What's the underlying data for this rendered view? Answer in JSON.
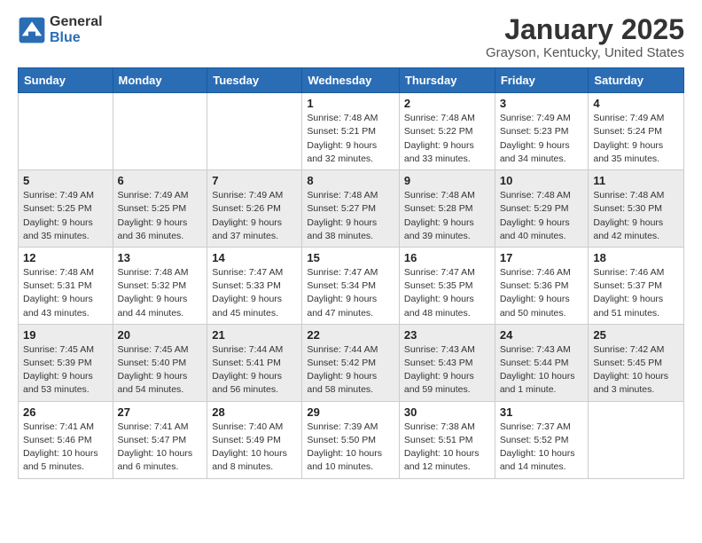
{
  "logo": {
    "general": "General",
    "blue": "Blue"
  },
  "title": "January 2025",
  "location": "Grayson, Kentucky, United States",
  "days_of_week": [
    "Sunday",
    "Monday",
    "Tuesday",
    "Wednesday",
    "Thursday",
    "Friday",
    "Saturday"
  ],
  "weeks": [
    [
      {
        "day": "",
        "info": ""
      },
      {
        "day": "",
        "info": ""
      },
      {
        "day": "",
        "info": ""
      },
      {
        "day": "1",
        "info": "Sunrise: 7:48 AM\nSunset: 5:21 PM\nDaylight: 9 hours and 32 minutes."
      },
      {
        "day": "2",
        "info": "Sunrise: 7:48 AM\nSunset: 5:22 PM\nDaylight: 9 hours and 33 minutes."
      },
      {
        "day": "3",
        "info": "Sunrise: 7:49 AM\nSunset: 5:23 PM\nDaylight: 9 hours and 34 minutes."
      },
      {
        "day": "4",
        "info": "Sunrise: 7:49 AM\nSunset: 5:24 PM\nDaylight: 9 hours and 35 minutes."
      }
    ],
    [
      {
        "day": "5",
        "info": "Sunrise: 7:49 AM\nSunset: 5:25 PM\nDaylight: 9 hours and 35 minutes."
      },
      {
        "day": "6",
        "info": "Sunrise: 7:49 AM\nSunset: 5:25 PM\nDaylight: 9 hours and 36 minutes."
      },
      {
        "day": "7",
        "info": "Sunrise: 7:49 AM\nSunset: 5:26 PM\nDaylight: 9 hours and 37 minutes."
      },
      {
        "day": "8",
        "info": "Sunrise: 7:48 AM\nSunset: 5:27 PM\nDaylight: 9 hours and 38 minutes."
      },
      {
        "day": "9",
        "info": "Sunrise: 7:48 AM\nSunset: 5:28 PM\nDaylight: 9 hours and 39 minutes."
      },
      {
        "day": "10",
        "info": "Sunrise: 7:48 AM\nSunset: 5:29 PM\nDaylight: 9 hours and 40 minutes."
      },
      {
        "day": "11",
        "info": "Sunrise: 7:48 AM\nSunset: 5:30 PM\nDaylight: 9 hours and 42 minutes."
      }
    ],
    [
      {
        "day": "12",
        "info": "Sunrise: 7:48 AM\nSunset: 5:31 PM\nDaylight: 9 hours and 43 minutes."
      },
      {
        "day": "13",
        "info": "Sunrise: 7:48 AM\nSunset: 5:32 PM\nDaylight: 9 hours and 44 minutes."
      },
      {
        "day": "14",
        "info": "Sunrise: 7:47 AM\nSunset: 5:33 PM\nDaylight: 9 hours and 45 minutes."
      },
      {
        "day": "15",
        "info": "Sunrise: 7:47 AM\nSunset: 5:34 PM\nDaylight: 9 hours and 47 minutes."
      },
      {
        "day": "16",
        "info": "Sunrise: 7:47 AM\nSunset: 5:35 PM\nDaylight: 9 hours and 48 minutes."
      },
      {
        "day": "17",
        "info": "Sunrise: 7:46 AM\nSunset: 5:36 PM\nDaylight: 9 hours and 50 minutes."
      },
      {
        "day": "18",
        "info": "Sunrise: 7:46 AM\nSunset: 5:37 PM\nDaylight: 9 hours and 51 minutes."
      }
    ],
    [
      {
        "day": "19",
        "info": "Sunrise: 7:45 AM\nSunset: 5:39 PM\nDaylight: 9 hours and 53 minutes."
      },
      {
        "day": "20",
        "info": "Sunrise: 7:45 AM\nSunset: 5:40 PM\nDaylight: 9 hours and 54 minutes."
      },
      {
        "day": "21",
        "info": "Sunrise: 7:44 AM\nSunset: 5:41 PM\nDaylight: 9 hours and 56 minutes."
      },
      {
        "day": "22",
        "info": "Sunrise: 7:44 AM\nSunset: 5:42 PM\nDaylight: 9 hours and 58 minutes."
      },
      {
        "day": "23",
        "info": "Sunrise: 7:43 AM\nSunset: 5:43 PM\nDaylight: 9 hours and 59 minutes."
      },
      {
        "day": "24",
        "info": "Sunrise: 7:43 AM\nSunset: 5:44 PM\nDaylight: 10 hours and 1 minute."
      },
      {
        "day": "25",
        "info": "Sunrise: 7:42 AM\nSunset: 5:45 PM\nDaylight: 10 hours and 3 minutes."
      }
    ],
    [
      {
        "day": "26",
        "info": "Sunrise: 7:41 AM\nSunset: 5:46 PM\nDaylight: 10 hours and 5 minutes."
      },
      {
        "day": "27",
        "info": "Sunrise: 7:41 AM\nSunset: 5:47 PM\nDaylight: 10 hours and 6 minutes."
      },
      {
        "day": "28",
        "info": "Sunrise: 7:40 AM\nSunset: 5:49 PM\nDaylight: 10 hours and 8 minutes."
      },
      {
        "day": "29",
        "info": "Sunrise: 7:39 AM\nSunset: 5:50 PM\nDaylight: 10 hours and 10 minutes."
      },
      {
        "day": "30",
        "info": "Sunrise: 7:38 AM\nSunset: 5:51 PM\nDaylight: 10 hours and 12 minutes."
      },
      {
        "day": "31",
        "info": "Sunrise: 7:37 AM\nSunset: 5:52 PM\nDaylight: 10 hours and 14 minutes."
      },
      {
        "day": "",
        "info": ""
      }
    ]
  ]
}
